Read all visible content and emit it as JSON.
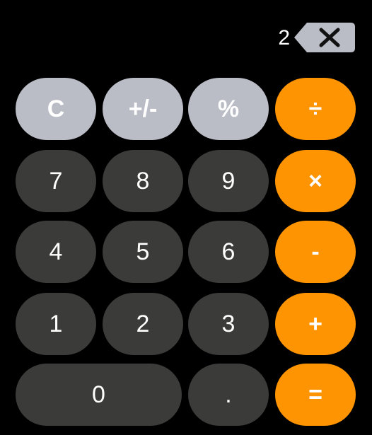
{
  "display": {
    "value": "2"
  },
  "keys": {
    "clear": "C",
    "sign": "+/-",
    "percent": "%",
    "divide": "÷",
    "seven": "7",
    "eight": "8",
    "nine": "9",
    "multiply": "×",
    "four": "4",
    "five": "5",
    "six": "6",
    "subtract": "-",
    "one": "1",
    "two": "2",
    "three": "3",
    "add": "+",
    "zero": "0",
    "decimal": ".",
    "equals": "="
  },
  "icons": {
    "backspace": "backspace-icon"
  },
  "colors": {
    "background": "#000000",
    "function_key": "#babcc6",
    "number_key": "#3b3b39",
    "operator_key": "#fe9402",
    "text": "#ffffff"
  }
}
